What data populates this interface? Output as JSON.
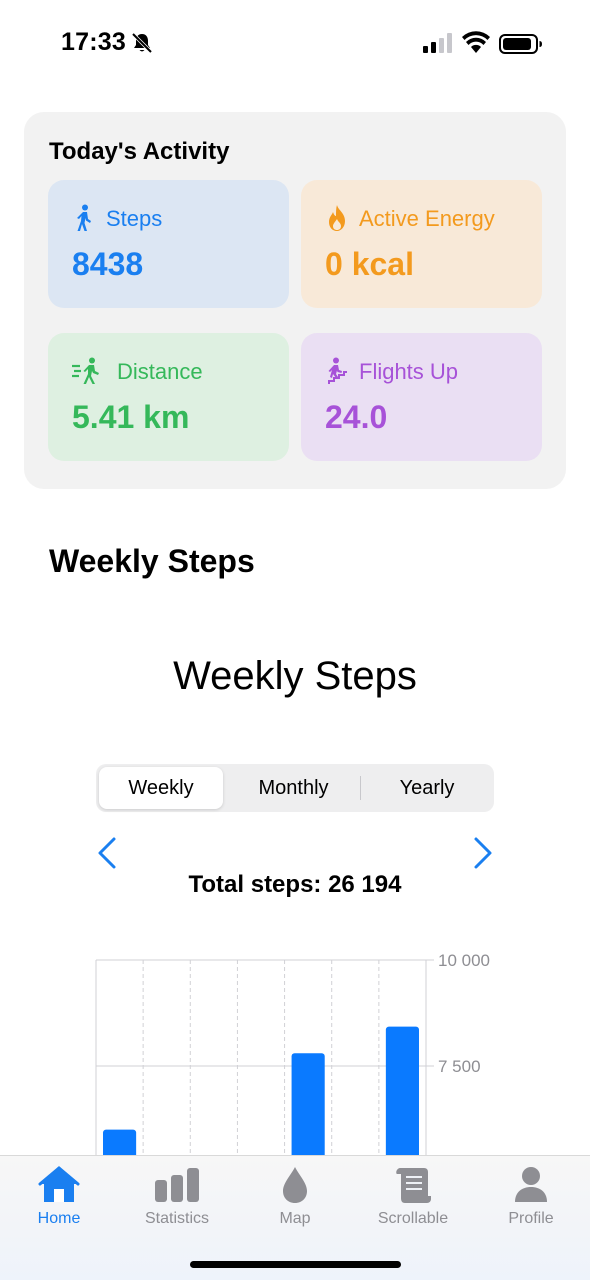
{
  "status_bar": {
    "time": "17:33"
  },
  "activity": {
    "title": "Today's Activity",
    "tiles": [
      {
        "label": "Steps",
        "value": "8438",
        "icon": "walking-figure-icon",
        "color": "#1a7ff0"
      },
      {
        "label": "Active Energy",
        "value": "0 kcal",
        "icon": "flame-icon",
        "color": "#f39a1e"
      },
      {
        "label": "Distance",
        "value": "5.41 km",
        "icon": "running-figure-icon",
        "color": "#35b85a"
      },
      {
        "label": "Flights Up",
        "value": "24.0",
        "icon": "stairs-climbing-icon",
        "color": "#a752d8"
      }
    ]
  },
  "section_heading": "Weekly Steps",
  "chart_title": "Weekly Steps",
  "segmented": {
    "options": [
      "Weekly",
      "Monthly",
      "Yearly"
    ],
    "selected": "Weekly"
  },
  "total_steps": "Total steps: 26 194",
  "chart_data": {
    "type": "bar",
    "title": "Weekly Steps",
    "y_tick_labels": [
      "10 000",
      "7 500"
    ],
    "ylim_visible": [
      5400,
      10000
    ],
    "values": [
      6000,
      0,
      0,
      0,
      7800,
      0,
      8430
    ],
    "bar_color": "#0a7aff",
    "grid": true
  },
  "tab_bar": {
    "items": [
      {
        "label": "Home",
        "icon": "house-icon",
        "active": true
      },
      {
        "label": "Statistics",
        "icon": "bar-chart-icon",
        "active": false
      },
      {
        "label": "Map",
        "icon": "drop-icon",
        "active": false
      },
      {
        "label": "Scrollable",
        "icon": "scroll-icon",
        "active": false
      },
      {
        "label": "Profile",
        "icon": "person-icon",
        "active": false
      }
    ],
    "accent": "#1a7ff0"
  }
}
